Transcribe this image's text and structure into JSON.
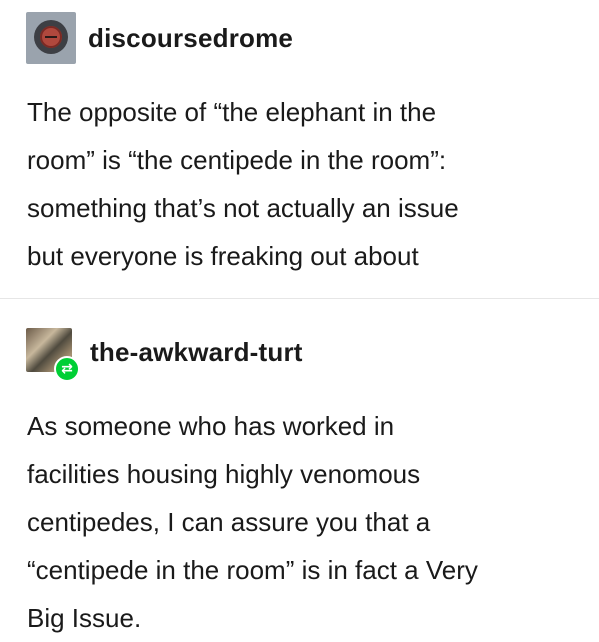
{
  "posts": [
    {
      "username": "discoursedrome",
      "avatar_icon": "red-circle-avatar-icon",
      "text": "The opposite of “the elephant in the\nroom” is “the centipede in the room”:\nsomething that’s not actually an issue\nbut everyone is freaking out about"
    },
    {
      "username": "the-awkward-turt",
      "avatar_icon": "photo-avatar-icon",
      "badge_icon": "reblog-icon",
      "text": "As someone who has worked in\nfacilities housing highly venomous\ncentipedes, I can assure you that a\n“centipede in the room” is in fact a Very\nBig Issue."
    }
  ],
  "colors": {
    "text": "#1a1a1a",
    "divider": "#e6e6e6",
    "reblog_badge": "#00cf35"
  }
}
